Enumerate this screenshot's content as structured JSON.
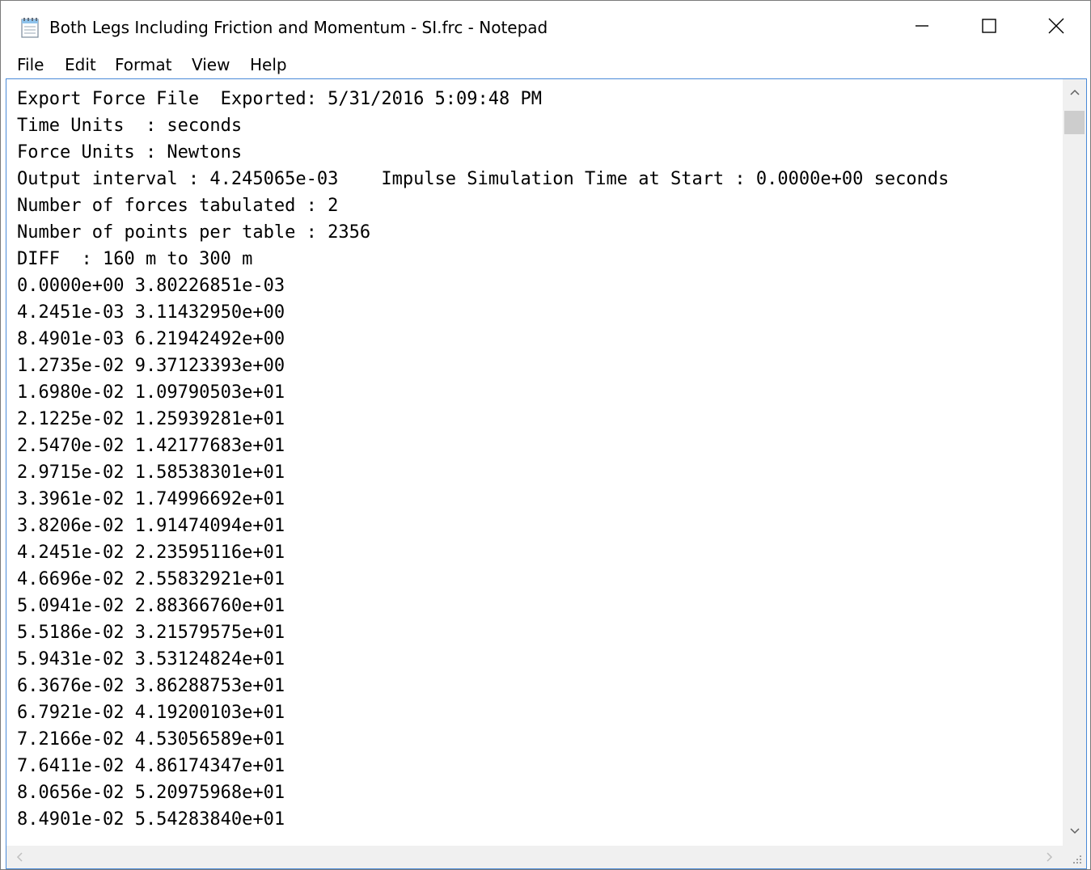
{
  "window": {
    "title": "Both Legs Including Friction and Momentum - SI.frc - Notepad",
    "icon": "notepad-icon"
  },
  "menu": {
    "file": "File",
    "edit": "Edit",
    "format": "Format",
    "view": "View",
    "help": "Help"
  },
  "document": {
    "lines": [
      "Export Force File  Exported: 5/31/2016 5:09:48 PM",
      "Time Units  : seconds",
      "Force Units : Newtons",
      "Output interval : 4.245065e-03    Impulse Simulation Time at Start : 0.0000e+00 seconds",
      "Number of forces tabulated : 2",
      "Number of points per table : 2356",
      "DIFF  : 160 m to 300 m",
      "0.0000e+00 3.80226851e-03",
      "4.2451e-03 3.11432950e+00",
      "8.4901e-03 6.21942492e+00",
      "1.2735e-02 9.37123393e+00",
      "1.6980e-02 1.09790503e+01",
      "2.1225e-02 1.25939281e+01",
      "2.5470e-02 1.42177683e+01",
      "2.9715e-02 1.58538301e+01",
      "3.3961e-02 1.74996692e+01",
      "3.8206e-02 1.91474094e+01",
      "4.2451e-02 2.23595116e+01",
      "4.6696e-02 2.55832921e+01",
      "5.0941e-02 2.88366760e+01",
      "5.5186e-02 3.21579575e+01",
      "5.9431e-02 3.53124824e+01",
      "6.3676e-02 3.86288753e+01",
      "6.7921e-02 4.19200103e+01",
      "7.2166e-02 4.53056589e+01",
      "7.6411e-02 4.86174347e+01",
      "8.0656e-02 5.20975968e+01",
      "8.4901e-02 5.54283840e+01"
    ]
  },
  "colors": {
    "editor_border": "#4a8ad8",
    "scrollbar_bg": "#f0f0f0",
    "scroll_thumb": "#cdcdcd"
  }
}
